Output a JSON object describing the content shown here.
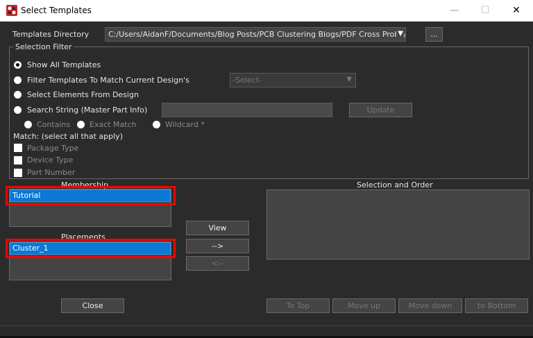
{
  "window": {
    "title": "Select Templates",
    "minimize": "—",
    "maximize": "☐",
    "close": "✕"
  },
  "directory": {
    "label": "Templates Directory",
    "value": "C:/Users/AidanF/Documents/Blog Posts/PCB Clustering Blogs/PDF Cross Probe/F",
    "browse": "..."
  },
  "filter": {
    "title": "Selection Filter",
    "options": [
      "Show All Templates",
      "Filter Templates To Match Current Design's",
      "Select Elements From Design",
      "Search String (Master Part Info)"
    ],
    "selected_option": "Show All Templates",
    "design_select_placeholder": "-Select-",
    "search_value": "",
    "update": "Update",
    "match_modes": [
      "Contains",
      "Exact Match",
      "Wildcard *"
    ],
    "match_label": "Match: (select all that apply)",
    "checks": [
      "Package Type",
      "Device Type",
      "Part Number"
    ]
  },
  "membership": {
    "label": "Membership",
    "items": [
      "Tutorial"
    ],
    "selected": "Tutorial"
  },
  "placements": {
    "label": "Placements",
    "items": [
      "Cluster_1"
    ],
    "selected": "Cluster_1"
  },
  "middle": {
    "view": "View",
    "add": "-->",
    "remove": "<--"
  },
  "order": {
    "label": "Selection and Order",
    "items": [],
    "to_top": "To Top",
    "move_up": "Move up",
    "move_down": "Move down",
    "to_bottom": "to Bottom"
  },
  "close": "Close",
  "colors": {
    "highlight": "#ff0000",
    "selection": "#0a78d4"
  }
}
